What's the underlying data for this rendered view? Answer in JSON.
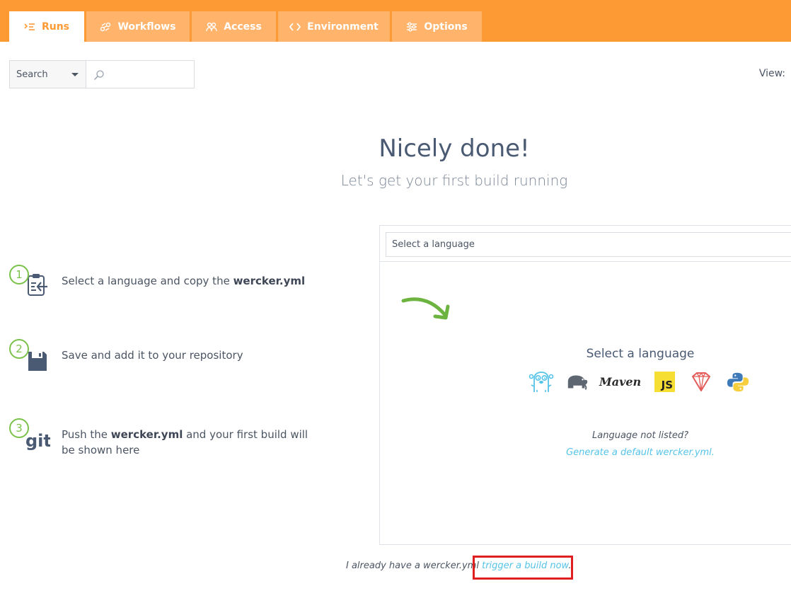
{
  "tabs": [
    {
      "label": "Runs",
      "icon": "runs-icon",
      "active": true
    },
    {
      "label": "Workflows",
      "icon": "workflows-icon",
      "active": false
    },
    {
      "label": "Access",
      "icon": "access-icon",
      "active": false
    },
    {
      "label": "Environment",
      "icon": "code-icon",
      "active": false
    },
    {
      "label": "Options",
      "icon": "sliders-icon",
      "active": false
    }
  ],
  "search": {
    "select_value": "Search",
    "input_value": ""
  },
  "view_label": "View:",
  "hero": {
    "title": "Nicely done!",
    "subtitle": "Let's get your first build running"
  },
  "steps": [
    {
      "number": "1",
      "icon": "clipboard-icon",
      "text_before": "Select a language and copy the ",
      "bold": "wercker.yml",
      "text_after": ""
    },
    {
      "number": "2",
      "icon": "save-icon",
      "text_before": "Save and add it to your repository",
      "bold": "",
      "text_after": ""
    },
    {
      "number": "3",
      "icon": "git-icon",
      "text_before": "Push the ",
      "bold": "wercker.yml",
      "text_after": " and your first build will be shown here"
    }
  ],
  "language_panel": {
    "select_value": "Select a language",
    "title": "Select a language",
    "languages": [
      "go-gopher-icon",
      "gradle-elephant-icon",
      "maven-icon",
      "javascript-icon",
      "ruby-icon",
      "python-icon"
    ],
    "maven_text": "Maven",
    "js_text": "JS",
    "not_listed": "Language not listed?",
    "generate_link": "Generate a default wercker.yml."
  },
  "footer": {
    "text": "I already have a wercker.yml",
    "link": "trigger a build now",
    "suffix": "."
  },
  "colors": {
    "brand_orange": "#fe9a33",
    "inactive_tab": "#ffb36b",
    "link_blue": "#55c3e8",
    "step_green": "#7bc24a",
    "highlight_red": "#e02020"
  }
}
